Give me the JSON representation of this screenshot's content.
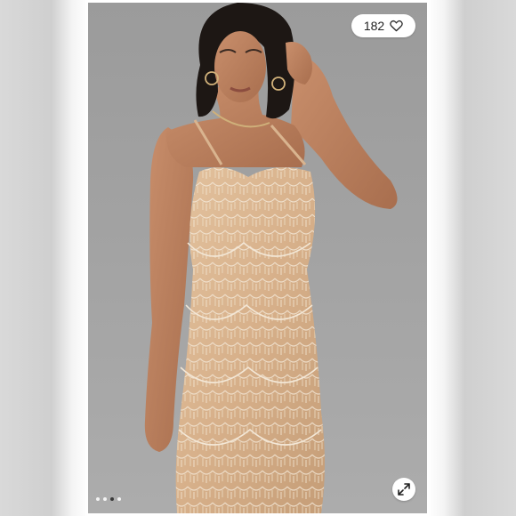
{
  "listing": {
    "like_count": "182",
    "like_icon": "heart-icon",
    "expand_icon": "expand-arrows-icon"
  },
  "carousel": {
    "total_images": 4,
    "active_index": 2
  },
  "photo": {
    "background_color": "#a3a3a3",
    "dress_color": "#d9b48f",
    "bead_color": "#efe2cf"
  }
}
